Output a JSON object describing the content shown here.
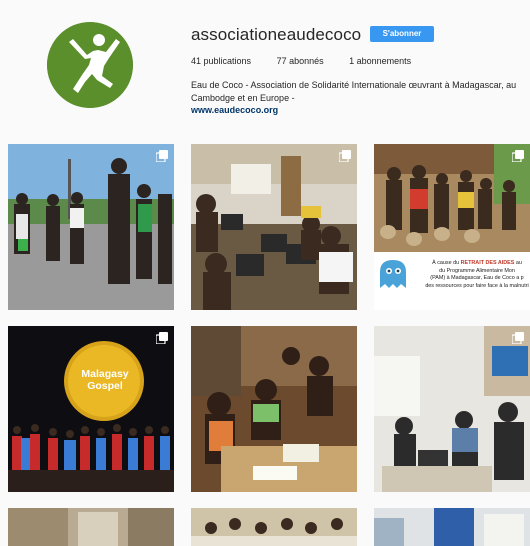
{
  "profile": {
    "username": "associationeaudecoco",
    "follow_label": "S'abonner",
    "stats": {
      "posts": "41 publications",
      "followers": "77 abonnés",
      "following": "1 abonnements"
    },
    "bio_text": "Eau de Coco - Association de Solidarité Internationale œuvrant à Madagascar, au Cambodge et en Europe -",
    "website": "www.eaudecoco.org"
  },
  "posts": [
    {
      "id": "post-1",
      "subject": "football-group-outdoors",
      "multiple": true
    },
    {
      "id": "post-2",
      "subject": "students-computer-room",
      "multiple": true
    },
    {
      "id": "post-3",
      "subject": "water-queue-infographic",
      "multiple": true,
      "overlay_text_a": "À cause du ",
      "overlay_text_b": "RETRAIT DES AIDES",
      "overlay_text_c": " au",
      "overlay_text_d": "du Programme Alimentaire Mon",
      "overlay_text_e": "(PAM) à Madagascar, Eau de Coco a p",
      "overlay_text_f": "des ressources pour faire face à la malnutri"
    },
    {
      "id": "post-4",
      "subject": "malagasy-gospel-concert",
      "multiple": true,
      "overlay_title": "Malagasy Gospel"
    },
    {
      "id": "post-5",
      "subject": "children-studying-table",
      "multiple": false
    },
    {
      "id": "post-6",
      "subject": "classroom-meeting",
      "multiple": true
    },
    {
      "id": "post-7",
      "subject": "stone-wall-partial",
      "multiple": false
    },
    {
      "id": "post-8",
      "subject": "group-photo-partial",
      "multiple": false
    },
    {
      "id": "post-9",
      "subject": "blue-building-partial",
      "multiple": false
    }
  ],
  "colors": {
    "follow_button": "#3897f0",
    "avatar_bg": "#5a8f2c",
    "link": "#003569"
  }
}
